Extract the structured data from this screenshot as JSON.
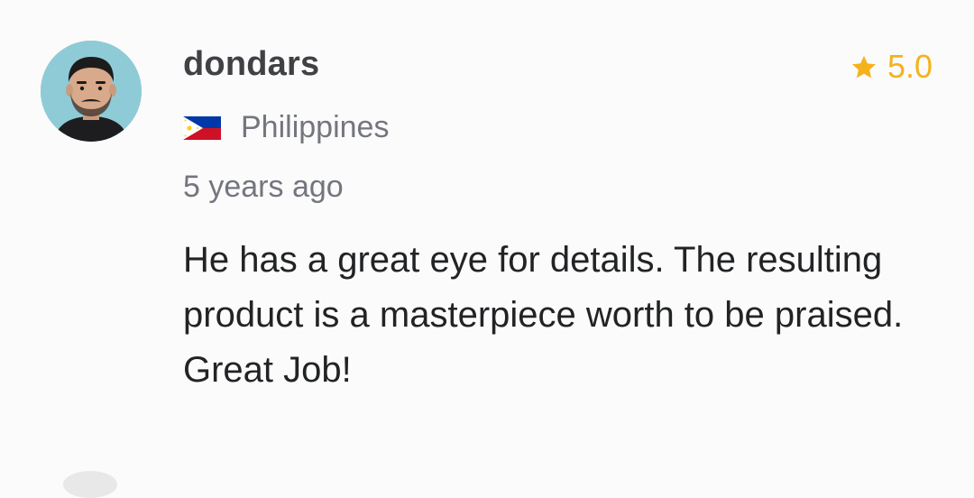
{
  "review": {
    "username": "dondars",
    "rating": "5.0",
    "country": "Philippines",
    "time_ago": "5 years ago",
    "text": "He has a great eye for details. The resulting product is a masterpiece worth to be praised. Great Job!",
    "avatar_icon": "user-avatar-icon",
    "flag_icon": "philippines-flag-icon",
    "star_icon": "star-icon"
  },
  "colors": {
    "rating": "#f5b21c",
    "username": "#404145",
    "muted": "#74767e",
    "body_text": "#222325",
    "background": "#fbfbfb"
  }
}
